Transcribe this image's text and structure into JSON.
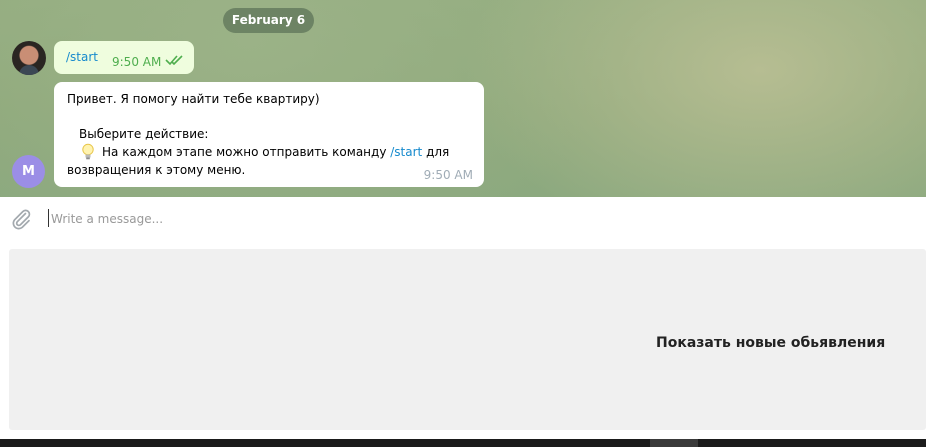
{
  "chat": {
    "date_label": "February 6",
    "outgoing": {
      "text": "/start",
      "time": "9:50 AM",
      "status_icon": "double-check-icon"
    },
    "incoming": {
      "line1": "Привет. Я помогу найти тебе квартиру)",
      "line2": "Выберите действие:",
      "line3_prefix": "На каждом этапе можно отправить команду ",
      "line3_command": "/start",
      "line3_suffix": " для",
      "line4": "возвращения к этому меню.",
      "time": "9:50 AM",
      "emoji_icon": "lightbulb-icon"
    },
    "bot_avatar_letter": "M"
  },
  "composer": {
    "placeholder": "Write a message...",
    "value": ""
  },
  "keyboard": {
    "button_label": "Показать новые обьявления"
  },
  "colors": {
    "accent": "#168acd",
    "outgoing_bubble": "#effdde",
    "check_color": "#4fae4e",
    "bot_avatar": "#9b8ee6"
  }
}
